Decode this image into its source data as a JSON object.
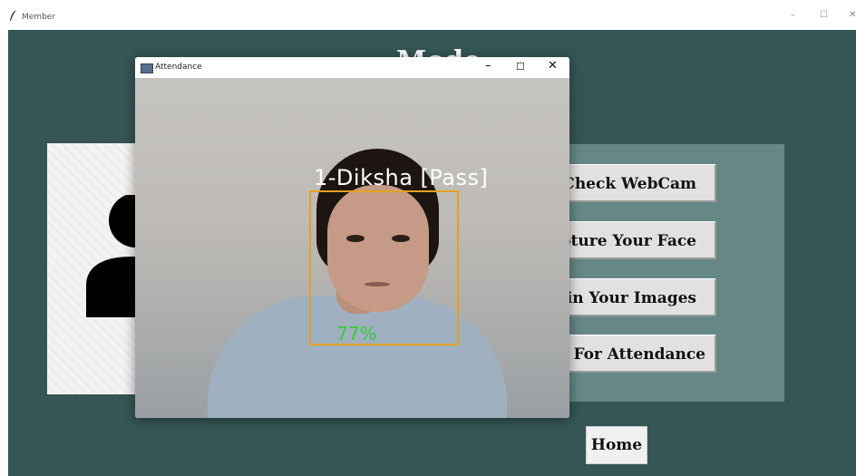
{
  "window": {
    "title": "Member",
    "controls": {
      "minimize": "–",
      "maximize": "☐",
      "close": "✕"
    }
  },
  "app": {
    "heading": "Mode",
    "buttons": [
      {
        "label": "Check WebCam"
      },
      {
        "label": "Capture Your Face"
      },
      {
        "label": "Train Your Images"
      },
      {
        "label": "Check For Attendance"
      }
    ],
    "home_label": "Home"
  },
  "attendance_window": {
    "title": "Attendance",
    "controls": {
      "minimize": "–",
      "maximize": "☐",
      "close": "✕"
    },
    "recognition": {
      "name_label": "1-Diksha [Pass]",
      "confidence": "77%"
    }
  },
  "colors": {
    "app_background": "#365656",
    "button_panel": "#658887",
    "face_box": "#e6a020",
    "confidence_text": "#38c838"
  }
}
